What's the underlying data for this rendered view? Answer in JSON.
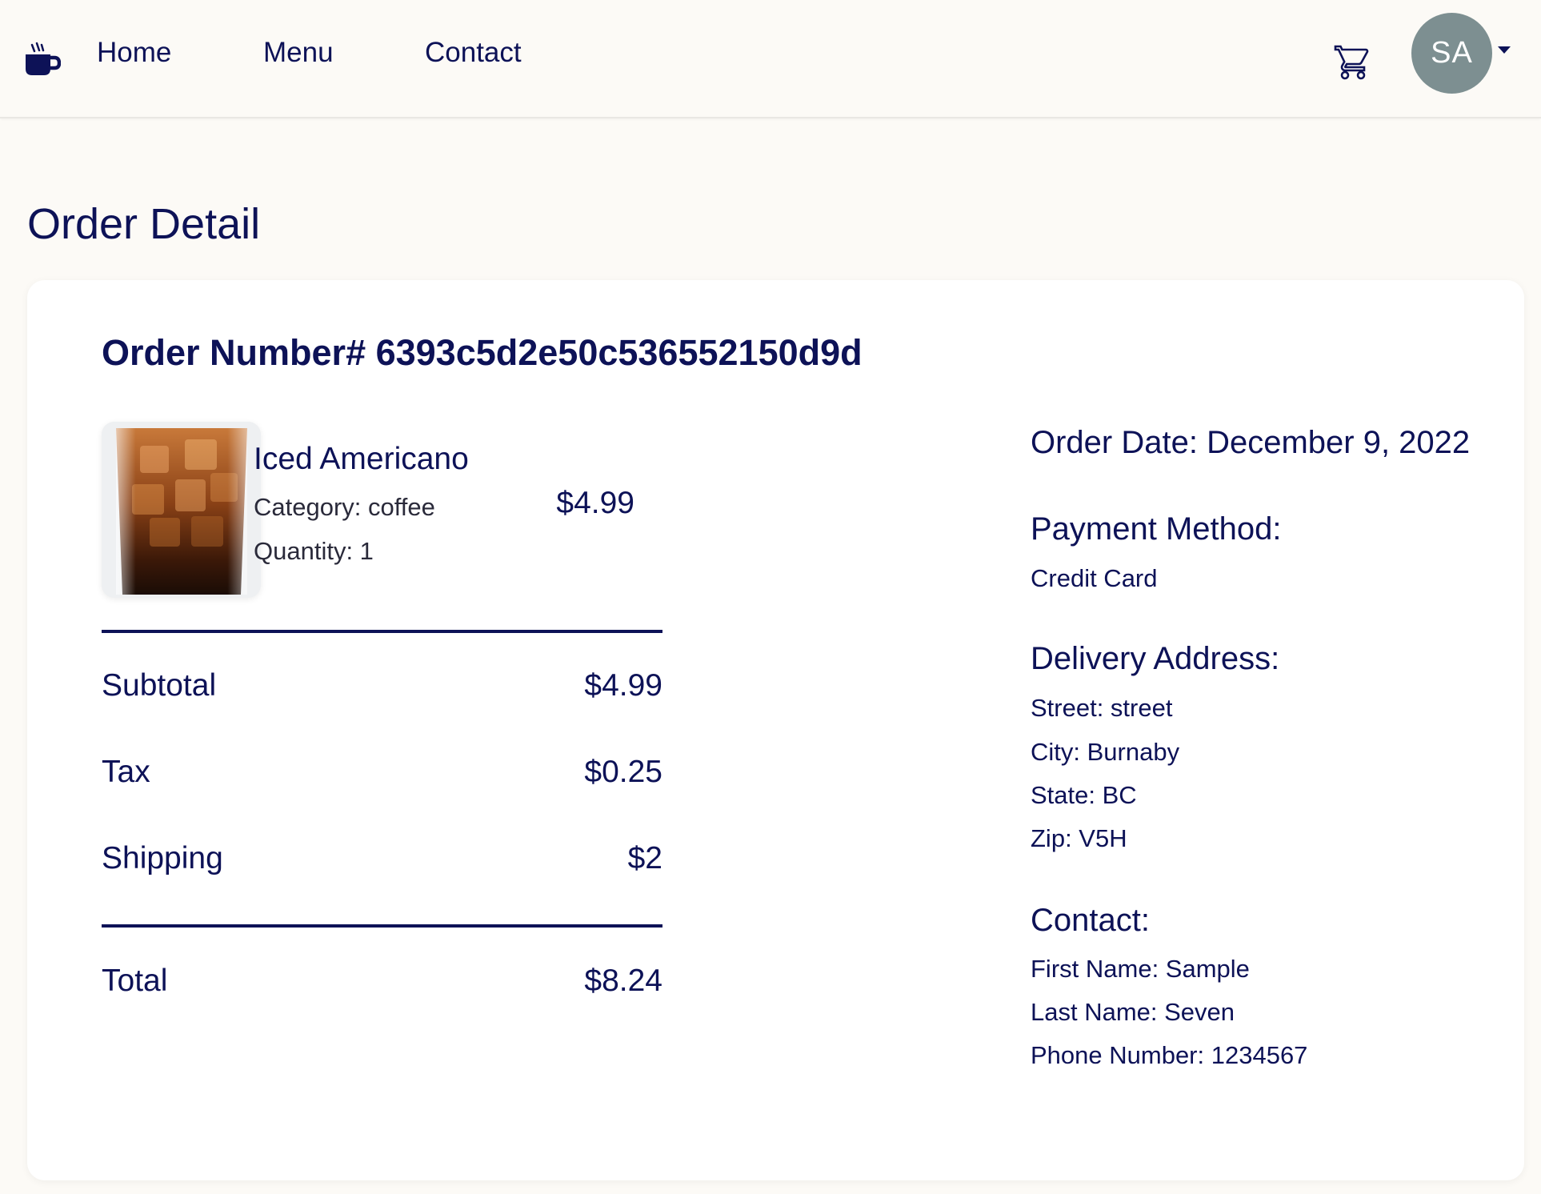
{
  "nav": {
    "brand_icon": "coffee-cup-icon",
    "links": [
      "Home",
      "Menu",
      "Contact"
    ],
    "cart_icon": "shopping-cart-icon",
    "avatar_initials": "SA"
  },
  "page": {
    "title": "Order Detail"
  },
  "order": {
    "number_label": "Order Number# 6393c5d2e50c536552150d9d",
    "item": {
      "name": "Iced Americano",
      "category": "Category: coffee",
      "quantity": "Quantity: 1",
      "price": "$4.99"
    },
    "summary": {
      "subtotal_label": "Subtotal",
      "subtotal_value": "$4.99",
      "tax_label": "Tax",
      "tax_value": "$0.25",
      "shipping_label": "Shipping",
      "shipping_value": "$2",
      "total_label": "Total",
      "total_value": "$8.24"
    },
    "info": {
      "order_date": "Order Date: December 9, 2022",
      "payment_heading": "Payment Method:",
      "payment_value": "Credit Card",
      "address_heading": "Delivery Address:",
      "street": "Street: street",
      "city": "City: Burnaby",
      "state": "State: BC",
      "zip": "Zip: V5H",
      "contact_heading": "Contact:",
      "first_name": "First Name: Sample",
      "last_name": "Last Name: Seven",
      "phone": "Phone Number: 1234567"
    }
  },
  "colors": {
    "background": "#fcfaf6",
    "text": "#0d1257",
    "card": "#ffffff",
    "avatar": "#7d8f91"
  }
}
